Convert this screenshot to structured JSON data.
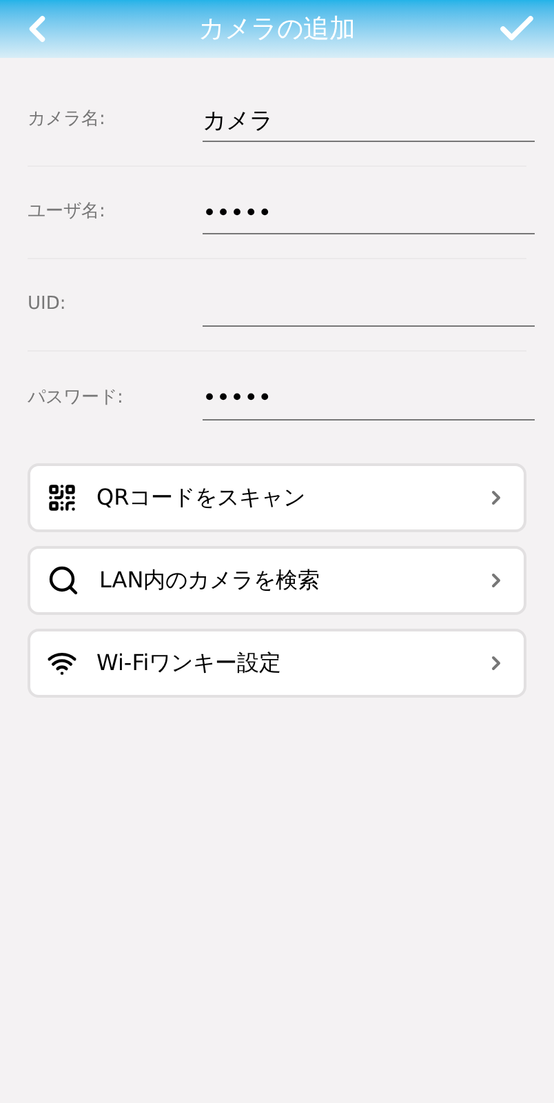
{
  "header": {
    "title": "カメラの追加"
  },
  "fields": [
    {
      "label": "カメラ名:",
      "value": "カメラ"
    },
    {
      "label": "ユーザ名:",
      "value": "•••••"
    },
    {
      "label": "UID:"
    },
    {
      "label": "パスワード:",
      "value": "•••••"
    }
  ],
  "actions": [
    {
      "kind": "qr",
      "label": "QRコードをスキャン"
    },
    {
      "kind": "search",
      "label": "LAN内のカメラを検索"
    },
    {
      "kind": "wifi",
      "label": "Wi-Fiワンキー設定"
    }
  ]
}
